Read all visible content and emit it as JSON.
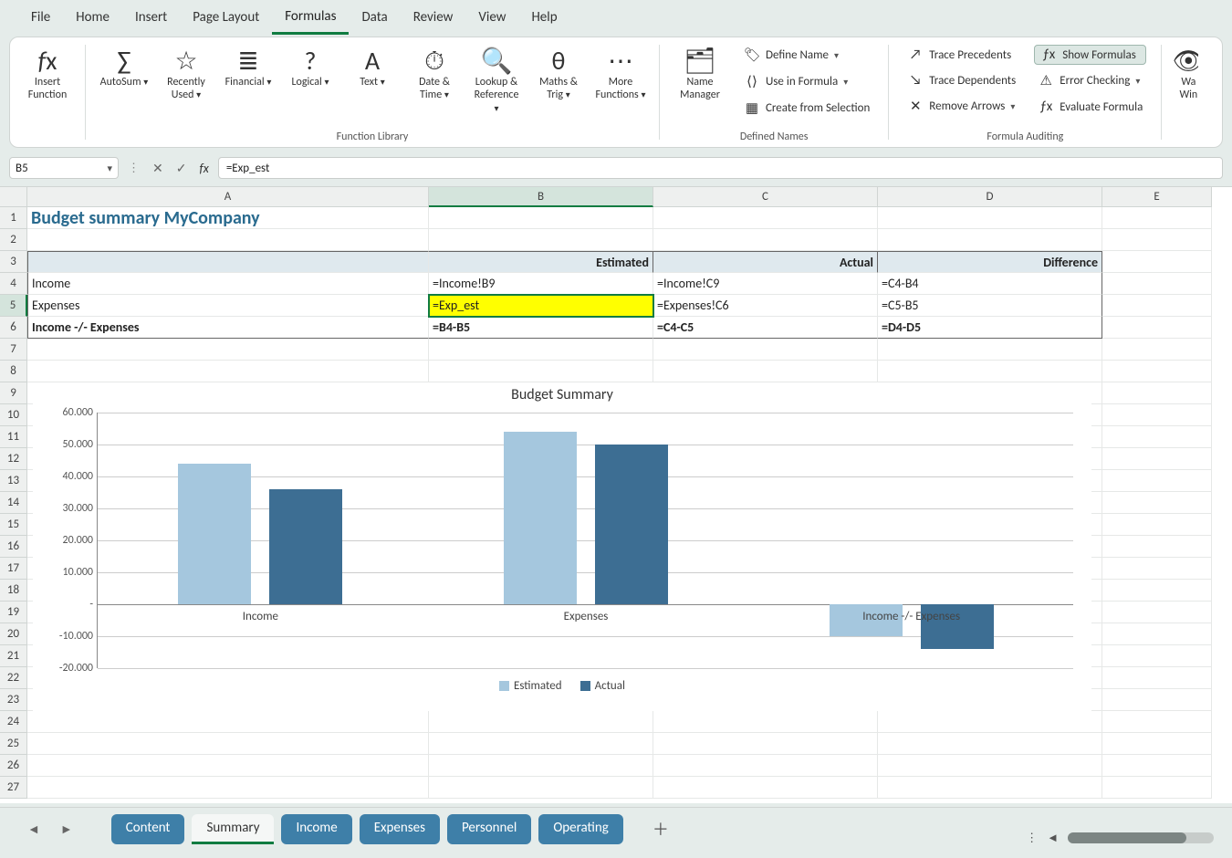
{
  "menu": {
    "tabs": [
      "File",
      "Home",
      "Insert",
      "Page Layout",
      "Formulas",
      "Data",
      "Review",
      "View",
      "Help"
    ],
    "active": "Formulas"
  },
  "ribbon": {
    "insert_function": "Insert Function",
    "library": {
      "label": "Function Library",
      "items": [
        {
          "icon": "∑",
          "label": "AutoSum",
          "drop": true
        },
        {
          "icon": "☆",
          "label": "Recently Used",
          "drop": true
        },
        {
          "icon": "≣",
          "label": "Financial",
          "drop": true
        },
        {
          "icon": "?",
          "label": "Logical",
          "drop": true
        },
        {
          "icon": "A",
          "label": "Text",
          "drop": true
        },
        {
          "icon": "⏱",
          "label": "Date & Time",
          "drop": true
        },
        {
          "icon": "🔍",
          "label": "Lookup & Reference",
          "drop": true
        },
        {
          "icon": "θ",
          "label": "Maths & Trig",
          "drop": true
        },
        {
          "icon": "⋯",
          "label": "More Functions",
          "drop": true
        }
      ]
    },
    "names": {
      "label": "Defined Names",
      "manager": "Name Manager",
      "define": "Define Name",
      "use": "Use in Formula",
      "create": "Create from Selection"
    },
    "audit": {
      "label": "Formula Auditing",
      "precedents": "Trace Precedents",
      "dependents": "Trace Dependents",
      "remove": "Remove Arrows",
      "show": "Show Formulas",
      "error": "Error Checking",
      "evaluate": "Evaluate Formula"
    },
    "watch_partial": "Wa",
    "window_partial": "Win"
  },
  "namebox": "B5",
  "formula_bar": "=Exp_est",
  "columns": [
    "A",
    "B",
    "C",
    "D",
    "E"
  ],
  "rows_visible": 27,
  "selected_row": 5,
  "selected_col": "B",
  "cells": {
    "A1": "Budget summary MyCompany",
    "B3": "Estimated",
    "C3": "Actual",
    "D3": "Difference",
    "A4": "Income",
    "B4": "=Income!B9",
    "C4": "=Income!C9",
    "D4": "=C4-B4",
    "A5": "Expenses",
    "B5": "=Exp_est",
    "C5": "=Expenses!C6",
    "D5": "=C5-B5",
    "A6": "Income -/- Expenses",
    "B6": "=B4-B5",
    "C6": "=C4-C5",
    "D6": "=D4-D5"
  },
  "chart_data": {
    "type": "bar",
    "title": "Budget Summary",
    "categories": [
      "Income",
      "Expenses",
      "Income -/- Expenses"
    ],
    "series": [
      {
        "name": "Estimated",
        "color": "#a5c7de",
        "values": [
          44000,
          54000,
          -10000
        ]
      },
      {
        "name": "Actual",
        "color": "#3d6e93",
        "values": [
          36000,
          50000,
          -14000
        ]
      }
    ],
    "ylim": [
      -20000,
      60000
    ],
    "yticks": [
      -20000,
      -10000,
      0,
      10000,
      20000,
      30000,
      40000,
      50000,
      60000
    ],
    "ytick_labels": [
      "-20.000",
      "-10.000",
      "-",
      "10.000",
      "20.000",
      "30.000",
      "40.000",
      "50.000",
      "60.000"
    ]
  },
  "sheets": {
    "tabs": [
      "Content",
      "Summary",
      "Income",
      "Expenses",
      "Personnel",
      "Operating"
    ],
    "active": "Summary"
  }
}
